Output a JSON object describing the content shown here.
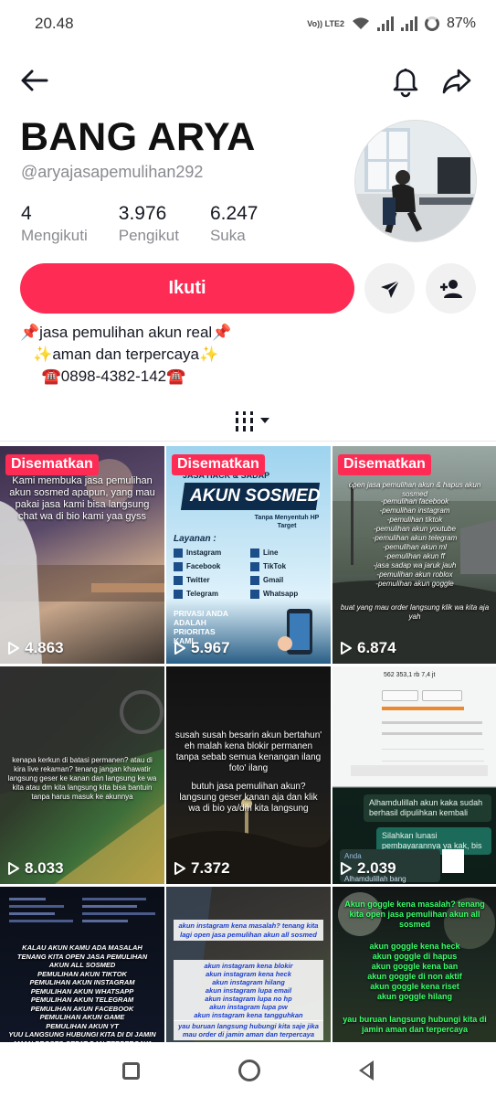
{
  "status_bar": {
    "time": "20.48",
    "network_label": "Vo)) LTE2",
    "battery": "87%"
  },
  "profile": {
    "display_name": "BANG ARYA",
    "username": "@aryajasapemulihan292",
    "stats": [
      {
        "value": "4",
        "label": "Mengikuti"
      },
      {
        "value": "3.976",
        "label": "Pengikut"
      },
      {
        "value": "6.247",
        "label": "Suka"
      }
    ],
    "follow_label": "Ikuti",
    "bio_lines": [
      "📌jasa pemulihan akun real📌",
      "   ✨aman dan terpercaya✨",
      "     ☎️0898-4382-142☎️"
    ]
  },
  "videos": [
    {
      "pinned_label": "Disematkan",
      "views": "4.863",
      "caption": "Kami membuka jasa pemulihan akun sosmed apapun, yang mau pakai jasa kami bisa langsung chat wa di bio kami yaa gyss"
    },
    {
      "pinned_label": "Disematkan",
      "views": "5.967",
      "header": "JASA HACK & SADAP",
      "title": "AKUN SOSMED",
      "subtitle": "Tanpa Menyentuh HP Target",
      "layanan_label": "Layanan :",
      "services": [
        "Instagram",
        "Facebook",
        "Twitter",
        "Telegram",
        "Line",
        "TikTok",
        "Gmail",
        "Whatsapp"
      ],
      "privacy_text": "PRIVASI ANDA ADALAH PRIORITAS KAMI."
    },
    {
      "pinned_label": "Disematkan",
      "views": "6.874",
      "caption": "open jasa pemulihan akun & hapus akun sosmed",
      "list": "-pemulihan facebook\n-pemulihan instagram\n-pemulihan tiktok\n-pemulihan akun youtube\n-pemulihan akun telegram\n-pemulihan akun ml\n-pemulihan akun ff\n-jasa sadap wa jaruk jauh\n-pemulihan akun roblox\n-pemulihan akun goggle",
      "footer": "buat yang mau order langsung klik wa kita aja yah"
    },
    {
      "views": "8.033",
      "caption": "kenapa kerkun di batasi permanen? atau di kira live rekaman? tenang jangan khawatir langsung geser ke kanan dan langsung ke wa kita atau dm kita langsung kita bisa bantuin tanpa harus masuk ke akunnya"
    },
    {
      "views": "7.372",
      "caption": "susah susah besarin akun bertahun' eh malah kena blokir permanen tanpa sebab semua kenangan ilang foto' ilang",
      "caption2": "butuh jasa pemulihan akun? langsung geser kanan aja dan klik wa di bio ya/dm kita langsung"
    },
    {
      "views": "2.039",
      "profile_stats": "562   353,1 rb   7,4 jt",
      "chat1": "Alhamdulillah akun kaka sudah berhasil dipulihkan kembali",
      "chat2": "Silahkan lunasi pembayarannya ya kak, bis",
      "chat3_name": "Anda",
      "chat3": "Alhamdulillah bang"
    },
    {
      "caption": "KALAU AKUN KAMU ADA MASALAH TENANG KITA OPEN JASA PEMULIHAN AKUN ALL SOSMED\nPEMULIHAN AKUN TIKTOK\nPEMULIHAN AKUN INSTAGRAM\nPEMULIHAN AKUN WHATSAPP\nPEMULIHAN AKUN TELEGRAM\nPEMULIHAN AKUN FACEBOOK\nPEMULIHAN AKUN GAME\nPEMULIHAN AKUN YT\nYUU LANGSUNG HUBUNGI KITA DI DI JAMIN AMAN PROSES CEPAT DAN TERPERCAYA"
    },
    {
      "caption": "akun instagram kena masalah? tenang kita lagi open jasa pemulihan akun all sosmed",
      "list": "akun instagram kena blokir\nakun instagram kena heck\nakun instagram hilang\nakun instagram lupa email\nakun instagram lupa no hp\nakun instagram lupa pw\nakun instagram kena tangguhkan",
      "footer": "yau buruan langsung hubungi kita saje jika mau order di jamin aman dan terpercaya"
    },
    {
      "caption": "Akun goggle kena masalah? tenang kita open jasa pemulihan akun all sosmed",
      "list": "akun goggle kena heck\nakun goggle di hapus\nakun goggle kena ban\nakun goggle di non aktif\nakun goggle kena riset\nakun goggle hilang",
      "footer": "yau buruan langsung hubungi kita di jamin aman dan terpercaya"
    }
  ],
  "colors": {
    "accent": "#fe2c55",
    "muted_text": "#8a8b91"
  }
}
